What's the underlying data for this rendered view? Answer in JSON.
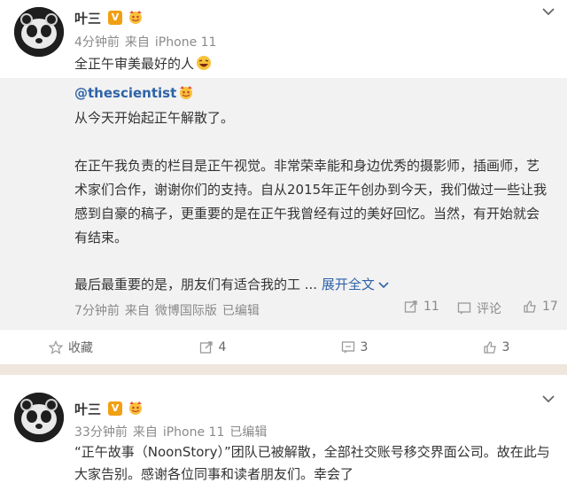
{
  "post1": {
    "author": "叶三",
    "v_badge": "V",
    "meta": {
      "time": "4分钟前",
      "from": "来自",
      "device": "iPhone 11"
    },
    "text": "全正午审美最好的人",
    "repost": {
      "author": "@thescientist",
      "lines": [
        "从今天开始起正午解散了。",
        "",
        "在正午我负责的栏目是正午视觉。非常荣幸能和身边优秀的摄影师，插画师，艺",
        "术家们合作，谢谢你们的支持。自从2015年正午创办到今天，我们做过一些让我",
        "感到自豪的稿子，更重要的是在正午我曾经有过的美好回忆。当然，有开始就会",
        "有结束。",
        "",
        "最后最重要的是，朋友们有适合我的工 ..."
      ],
      "expand_label": "展开全文",
      "meta": {
        "time": "7分钟前",
        "from": "来自",
        "client": "微博国际版",
        "edited": "已编辑"
      },
      "stats": {
        "reposts": "11",
        "comment_label": "评论",
        "likes": "17"
      }
    },
    "actions": {
      "favorite": "收藏",
      "repost": "4",
      "comment": "3",
      "like": "3"
    }
  },
  "post2": {
    "author": "叶三",
    "v_badge": "V",
    "meta": {
      "time": "33分钟前",
      "from": "来自",
      "device": "iPhone 11",
      "edited": "已编辑"
    },
    "lines": [
      "“正午故事（NoonStory）”团队已被解散，全部社交账号移交界面公司。故在此与",
      "大家告别。感谢各位同事和读者朋友们。幸会了"
    ]
  },
  "colors": {
    "orange": "#eb7350",
    "vip": "#f0a012",
    "gray": "#8a8a8a",
    "separator": "#efe6de",
    "repost_bg": "#f2f2f2"
  }
}
